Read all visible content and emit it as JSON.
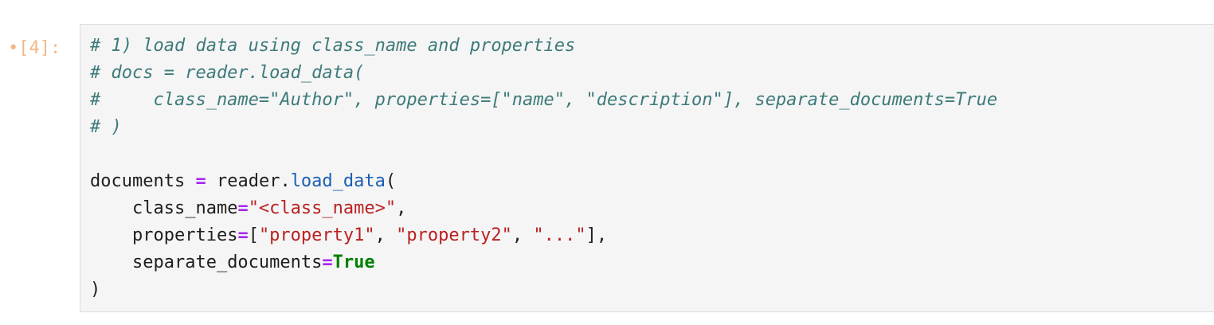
{
  "cell": {
    "prompt_bullet": "•",
    "prompt_label": "[4]:"
  },
  "code": {
    "comment_line_1": "# 1) load data using class_name and properties",
    "comment_line_2": "# docs = reader.load_data(",
    "comment_line_3": "#     class_name=\"Author\", properties=[\"name\", \"description\"], separate_documents=True",
    "comment_line_4": "# )",
    "documents_var": "documents",
    "assign_op": "=",
    "reader_obj": "reader.",
    "load_data_fn": "load_data",
    "open_paren": "(",
    "class_name_kw": "class_name",
    "eq": "=",
    "class_name_val": "\"<class_name>\"",
    "comma": ",",
    "properties_kw": "properties",
    "bracket_open": "[",
    "prop_1": "\"property1\"",
    "sep": ", ",
    "prop_2": "\"property2\"",
    "prop_3": "\"...\"",
    "bracket_close_comma": "],",
    "separate_documents_kw": "separate_documents",
    "true_kw": "True",
    "close_paren": ")"
  },
  "colors": {
    "prompt": "#f0b98a",
    "comment": "#3e7a7a",
    "operator": "#a626f0",
    "string": "#ba2121",
    "keyword": "#008000",
    "function": "#1a5fb4",
    "editor_bg": "#f5f5f5"
  }
}
